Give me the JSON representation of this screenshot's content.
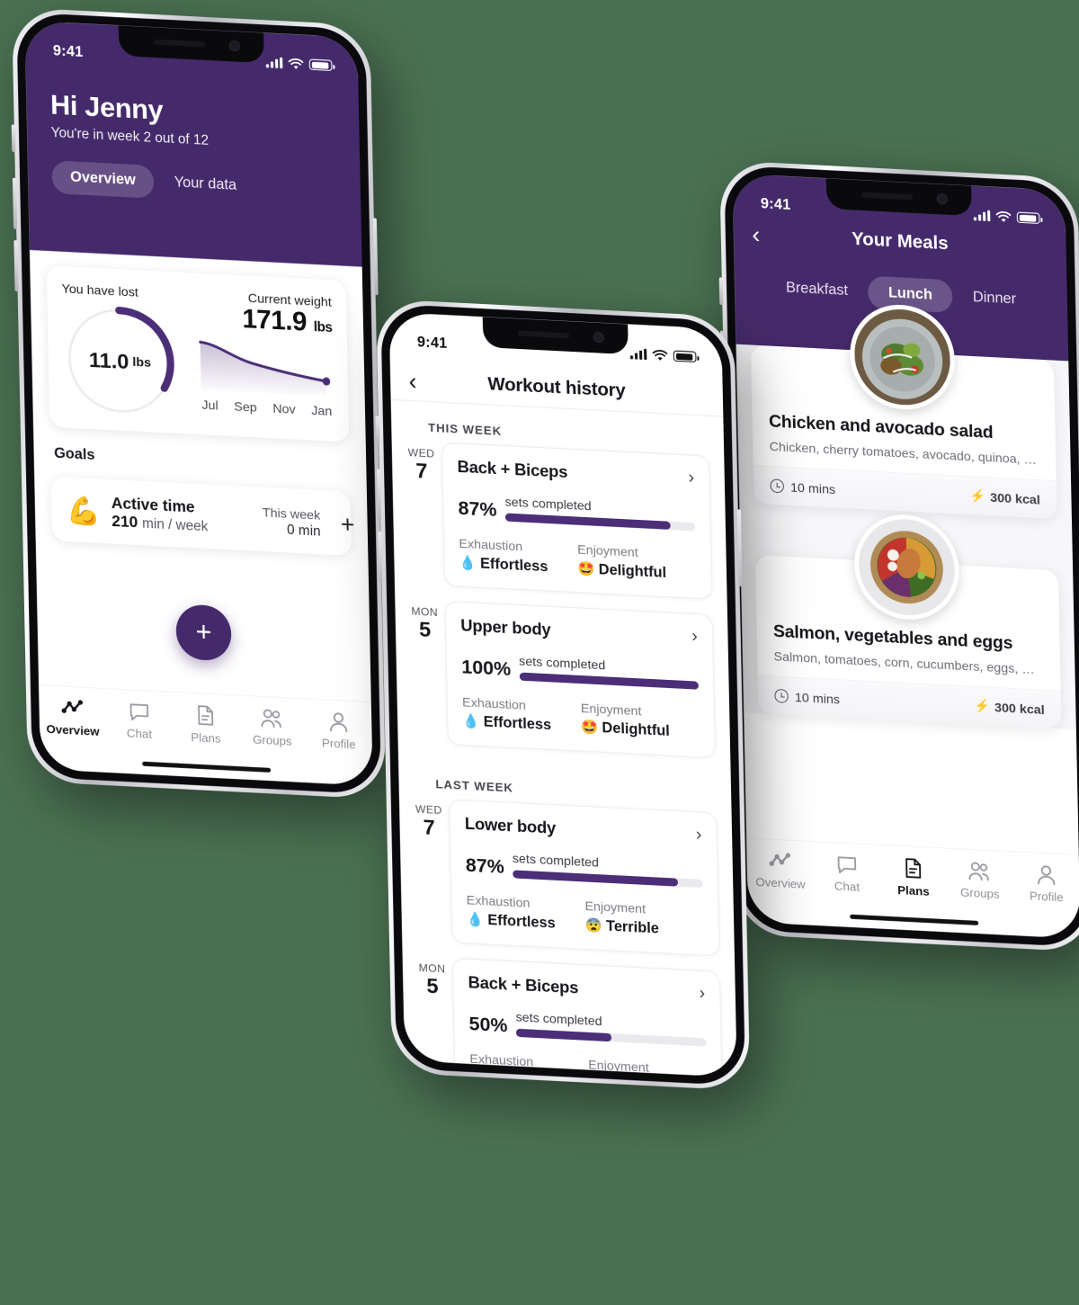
{
  "theme": {
    "background": "#4a7052",
    "brand_purple": "#452a6b",
    "progress_purple": "#4b2d78",
    "track_grey": "#eaeaee"
  },
  "phone1": {
    "status": {
      "time": "9:41",
      "signal_icon": "cellular-bars-icon",
      "wifi_icon": "wifi-icon",
      "battery_icon": "battery-icon"
    },
    "header": {
      "greeting": "Hi Jenny",
      "subtitle": "You're in week 2 out of 12",
      "tabs": [
        {
          "label": "Overview",
          "active": true
        },
        {
          "label": "Your data",
          "active": false
        }
      ]
    },
    "stats_card": {
      "lost_label": "You have lost",
      "lost_value": "11.0",
      "lost_unit": "lbs",
      "donut_percent": 33,
      "current_label": "Current weight",
      "current_value": "171.9",
      "current_unit": "lbs",
      "months": [
        "Jul",
        "Sep",
        "Nov",
        "Jan"
      ]
    },
    "goals_title": "Goals",
    "goal": {
      "emoji": "flexed-biceps-emoji",
      "emoji_char": "💪",
      "name": "Active time",
      "target_value": "210",
      "target_unit": "min / week",
      "period_label": "This week",
      "period_value": "0 min",
      "add_label": "+"
    },
    "fab_label": "+",
    "tabbar": [
      {
        "label": "Overview",
        "icon": "activity-chart-icon",
        "active": true
      },
      {
        "label": "Chat",
        "icon": "chat-bubble-icon",
        "active": false
      },
      {
        "label": "Plans",
        "icon": "document-icon",
        "active": false
      },
      {
        "label": "Groups",
        "icon": "people-group-icon",
        "active": false
      },
      {
        "label": "Profile",
        "icon": "person-icon",
        "active": false
      }
    ]
  },
  "phone2": {
    "status": {
      "time": "9:41"
    },
    "nav": {
      "back_icon": "chevron-left-icon",
      "title": "Workout history"
    },
    "sections": [
      {
        "label": "THIS WEEK",
        "workouts": [
          {
            "day": "WED",
            "date": "7",
            "name": "Back + Biceps",
            "percent": "87%",
            "percent_value": 87,
            "percent_caption": "sets completed",
            "exhaustion_label": "Exhaustion",
            "exhaustion_value": "Effortless",
            "exhaustion_emoji": "💧",
            "enjoyment_label": "Enjoyment",
            "enjoyment_value": "Delightful",
            "enjoyment_emoji": "🤩"
          },
          {
            "day": "MON",
            "date": "5",
            "name": "Upper body",
            "percent": "100%",
            "percent_value": 100,
            "percent_caption": "sets completed",
            "exhaustion_label": "Exhaustion",
            "exhaustion_value": "Effortless",
            "exhaustion_emoji": "💧",
            "enjoyment_label": "Enjoyment",
            "enjoyment_value": "Delightful",
            "enjoyment_emoji": "🤩"
          }
        ]
      },
      {
        "label": "LAST WEEK",
        "workouts": [
          {
            "day": "WED",
            "date": "7",
            "name": "Lower body",
            "percent": "87%",
            "percent_value": 87,
            "percent_caption": "sets completed",
            "exhaustion_label": "Exhaustion",
            "exhaustion_value": "Effortless",
            "exhaustion_emoji": "💧",
            "enjoyment_label": "Enjoyment",
            "enjoyment_value": "Terrible",
            "enjoyment_emoji": "😨"
          },
          {
            "day": "MON",
            "date": "5",
            "name": "Back + Biceps",
            "percent": "50%",
            "percent_value": 50,
            "percent_caption": "sets completed",
            "exhaustion_label": "Exhaustion",
            "exhaustion_value": "",
            "exhaustion_emoji": "",
            "enjoyment_label": "Enjoyment",
            "enjoyment_value": "",
            "enjoyment_emoji": ""
          }
        ]
      }
    ]
  },
  "phone3": {
    "status": {
      "time": "9:41"
    },
    "nav": {
      "back_icon": "chevron-left-icon",
      "title": "Your Meals"
    },
    "meal_tabs": [
      {
        "label": "Breakfast",
        "active": false
      },
      {
        "label": "Lunch",
        "active": true
      },
      {
        "label": "Dinner",
        "active": false
      }
    ],
    "meals": [
      {
        "image": "chicken-avocado-salad-photo",
        "name": "Chicken and avocado salad",
        "ingredients": "Chicken, cherry tomatoes, avocado, quinoa, …",
        "time": "10 mins",
        "calories": "300 kcal"
      },
      {
        "image": "salmon-vegetable-bowl-photo",
        "name": "Salmon, vegetables and eggs",
        "ingredients": "Salmon, tomatoes, corn, cucumbers, eggs, …",
        "time": "10 mins",
        "calories": "300 kcal"
      }
    ],
    "tabbar": [
      {
        "label": "Overview",
        "icon": "activity-chart-icon",
        "active": false
      },
      {
        "label": "Chat",
        "icon": "chat-bubble-icon",
        "active": false
      },
      {
        "label": "Plans",
        "icon": "document-icon",
        "active": true
      },
      {
        "label": "Groups",
        "icon": "people-group-icon",
        "active": false
      },
      {
        "label": "Profile",
        "icon": "person-icon",
        "active": false
      }
    ]
  }
}
